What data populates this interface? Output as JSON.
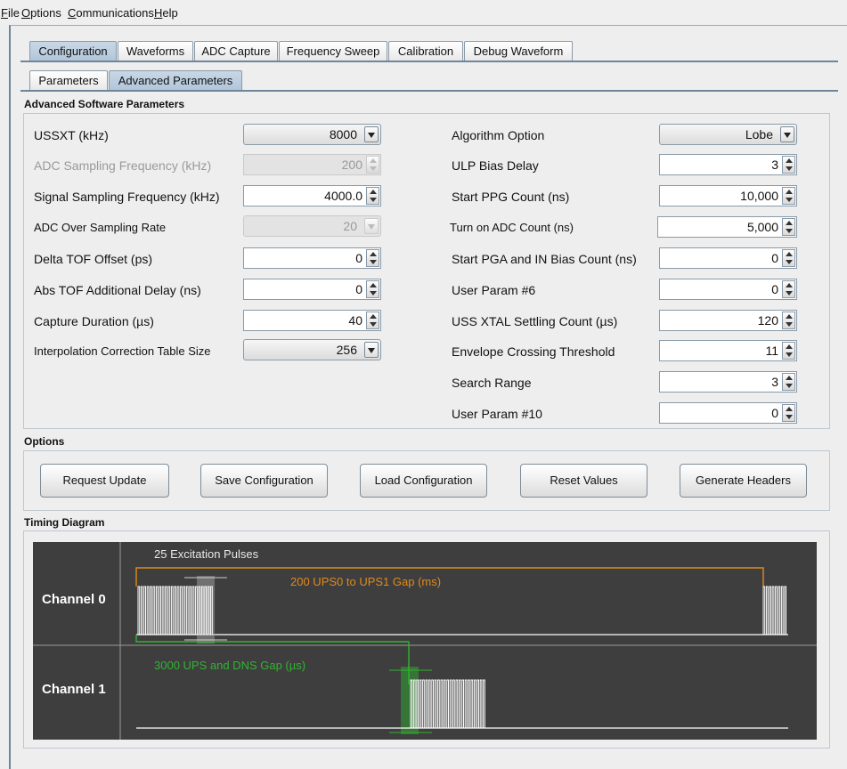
{
  "menubar": [
    {
      "first": "F",
      "rest": "ile"
    },
    {
      "first": "O",
      "rest": "ptions"
    },
    {
      "first": "C",
      "rest": "ommunications"
    },
    {
      "first": "H",
      "rest": "elp"
    }
  ],
  "tabs": [
    "Configuration",
    "Waveforms",
    "ADC Capture",
    "Frequency Sweep",
    "Calibration",
    "Debug Waveform"
  ],
  "subtabs": [
    "Parameters",
    "Advanced Parameters"
  ],
  "advanced": {
    "title": "Advanced Software Parameters",
    "left": [
      {
        "label": "USSXT (kHz)",
        "value": "8000"
      },
      {
        "label": "ADC Sampling Frequency (kHz)",
        "value": "200"
      },
      {
        "label": "Signal Sampling Frequency (kHz)",
        "value": "4000.0"
      },
      {
        "label": "ADC Over Sampling Rate",
        "value": "20"
      },
      {
        "label": "Delta TOF Offset (ps)",
        "value": "0"
      },
      {
        "label": "Abs TOF Additional Delay (ns)",
        "value": "0"
      },
      {
        "label": "Capture Duration (µs)",
        "value": "40"
      },
      {
        "label": "Interpolation Correction Table Size",
        "value": "256"
      }
    ],
    "right": [
      {
        "label": "Algorithm Option",
        "value": "Lobe"
      },
      {
        "label": "ULP Bias Delay",
        "value": "3"
      },
      {
        "label": "Start PPG Count (ns)",
        "value": "10,000"
      },
      {
        "label": "Turn on ADC Count (ns)",
        "value": "5,000"
      },
      {
        "label": "Start PGA and IN Bias Count (ns)",
        "value": "0"
      },
      {
        "label": "User Param #6",
        "value": "0"
      },
      {
        "label": "USS XTAL Settling Count (µs)",
        "value": "120"
      },
      {
        "label": "Envelope Crossing Threshold",
        "value": "11"
      },
      {
        "label": "Search Range",
        "value": "3"
      },
      {
        "label": "User Param #10",
        "value": "0"
      }
    ]
  },
  "options": {
    "title": "Options",
    "buttons": [
      "Request Update",
      "Save Configuration",
      "Load Configuration",
      "Reset Values",
      "Generate Headers"
    ]
  },
  "timing": {
    "title": "Timing Diagram",
    "channel0": "Channel 0",
    "channel1": "Channel 1",
    "pulses_label": "25 Excitation Pulses",
    "gap0_label": "200 UPS0 to UPS1 Gap (ms)",
    "gap1_label": "3000 UPS and DNS Gap (µs)",
    "colors": {
      "background": "#3e3e3e",
      "pulse": "#ffffff",
      "gap0": "#e08a1e",
      "gap1": "#2fb52f",
      "highlight": "#8c8c8c"
    }
  }
}
